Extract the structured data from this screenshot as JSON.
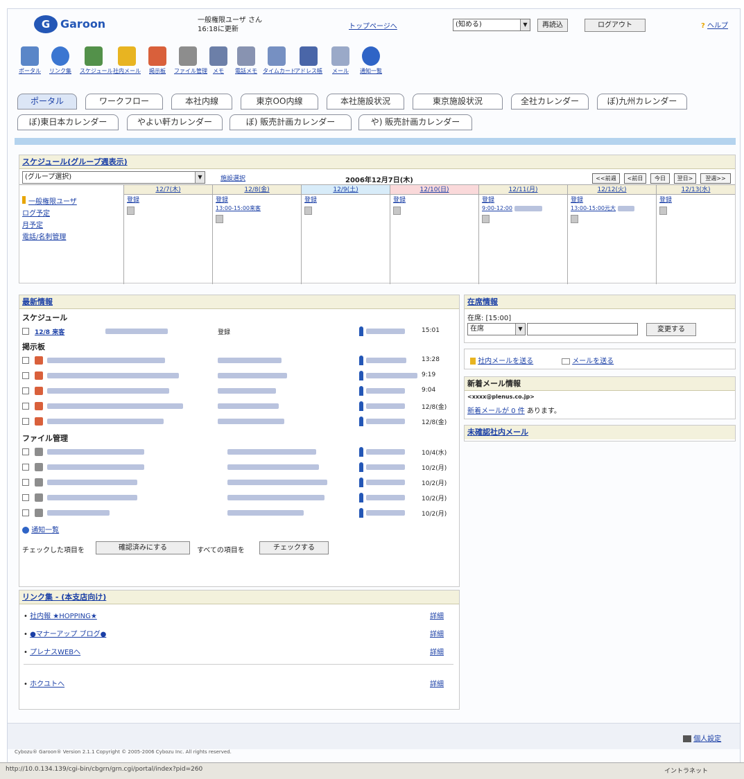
{
  "header": {
    "logo_mark": "G",
    "logo_text": "Garoon",
    "user_name": "一般権限ユーザ さん",
    "updated": "16:18に更新",
    "top_link": "トップページへ",
    "view_select": "(知める)",
    "reload_btn": "再読込",
    "logout_btn": "ログアウト",
    "help": "ヘルプ"
  },
  "apps": [
    {
      "label": "ポータル",
      "color": "#5a86c8"
    },
    {
      "label": "リンク集",
      "color": "#3b76d1"
    },
    {
      "label": "スケジュール",
      "color": "#53914a"
    },
    {
      "label": "社内メール",
      "color": "#e8b421"
    },
    {
      "label": "掲示板",
      "color": "#d9603b"
    },
    {
      "label": "ファイル管理",
      "color": "#8d8d8d"
    },
    {
      "label": "メモ",
      "color": "#6c7fa8"
    },
    {
      "label": "電話メモ",
      "color": "#8893b1"
    },
    {
      "label": "タイムカード",
      "color": "#7690c2"
    },
    {
      "label": "アドレス帳",
      "color": "#4a66a8"
    },
    {
      "label": "メール",
      "color": "#9aa9c8"
    },
    {
      "label": "通知一覧",
      "color": "#2f64c6"
    }
  ],
  "tabs": [
    {
      "label": "ポータル",
      "active": true
    },
    {
      "label": "ワークフロー"
    },
    {
      "label": "本社内線"
    },
    {
      "label": "東京OO内線"
    },
    {
      "label": "本社施設状況"
    },
    {
      "label": "東京施設状況"
    },
    {
      "label": "全社カレンダー"
    },
    {
      "label": "ぼ)九州カレンダー"
    },
    {
      "label": "ぼ)東日本カレンダー"
    },
    {
      "label": "やよい軒カレンダー"
    },
    {
      "label": "ぼ) 販売計画カレンダー"
    },
    {
      "label": "や) 販売計画カレンダー"
    }
  ],
  "schedule": {
    "title": "スケジュール(グループ週表示)",
    "group_select": "(グループ選択)",
    "facility_link": "施設選択",
    "current_date": "2006年12月7日(木)",
    "nav": [
      "<<前週",
      "<前日",
      "今日",
      "翌日>",
      "翌週>>"
    ],
    "days": [
      {
        "label": "12/7(木)",
        "kind": "normal"
      },
      {
        "label": "12/8(金)",
        "kind": "normal"
      },
      {
        "label": "12/9(土)",
        "kind": "sat"
      },
      {
        "label": "12/10(日)",
        "kind": "sun"
      },
      {
        "label": "12/11(月)",
        "kind": "normal"
      },
      {
        "label": "12/12(火)",
        "kind": "normal"
      },
      {
        "label": "12/13(水)",
        "kind": "normal"
      }
    ],
    "register": "登録",
    "events": [
      "13:00-15:00来客",
      "9:00-12:00",
      "13:00-15:00元大"
    ],
    "user_links": [
      "一般権限ユーザ",
      "ログ予定",
      "月予定",
      "電話/名刺管理"
    ]
  },
  "latest": {
    "title": "最新情報",
    "schedule_section": "スケジュール",
    "schedule_item": "12/8 来客",
    "register_label": "登録",
    "board_section": "掲示板",
    "file_section": "ファイル管理",
    "board_times": [
      "13:28",
      "9:19",
      "9:04",
      "12/8(金)",
      "12/8(金)"
    ],
    "file_times": [
      "10/4(水)",
      "10/2(月)",
      "10/2(月)",
      "10/2(月)",
      "10/2(月)"
    ],
    "notify_link": "通知一覧",
    "sched_time": "15:01",
    "mark_checked_prefix": "チェックした項目を",
    "mark_checked_btn": "確認済みにする",
    "check_all_prefix": "すべての項目を",
    "check_all_btn": "チェックする"
  },
  "links": {
    "title": "リンク集 - (本支店向け)",
    "items": [
      "社内報 ★HOPPING★",
      "●マナーアップ ブログ●",
      "プレナスWEBへ",
      "ホクユトへ"
    ],
    "detail": "詳細"
  },
  "presence": {
    "title": "在席情報",
    "status_line": "在席: [15:00]",
    "select": "在席",
    "change_btn": "変更する"
  },
  "mail": {
    "internal": "社内メールを送る",
    "send": "メールを送る",
    "new_title": "新着メール情報",
    "address": "<xxxx@plenus.co.jp>",
    "count_text": "新着メールが 0 件",
    "count_suffix": " あります。",
    "unread": "未確認社内メール"
  },
  "footer": {
    "personal": "個人設定",
    "copyright": "Cybozu® Garoon® Version 2.1.1    Copyright © 2005-2006 Cybozu Inc. All rights reserved.",
    "status_url": "http://10.0.134.139/cgi-bin/cbgrn/grn.cgi/portal/index?pid=260",
    "zone": "イントラネット"
  }
}
